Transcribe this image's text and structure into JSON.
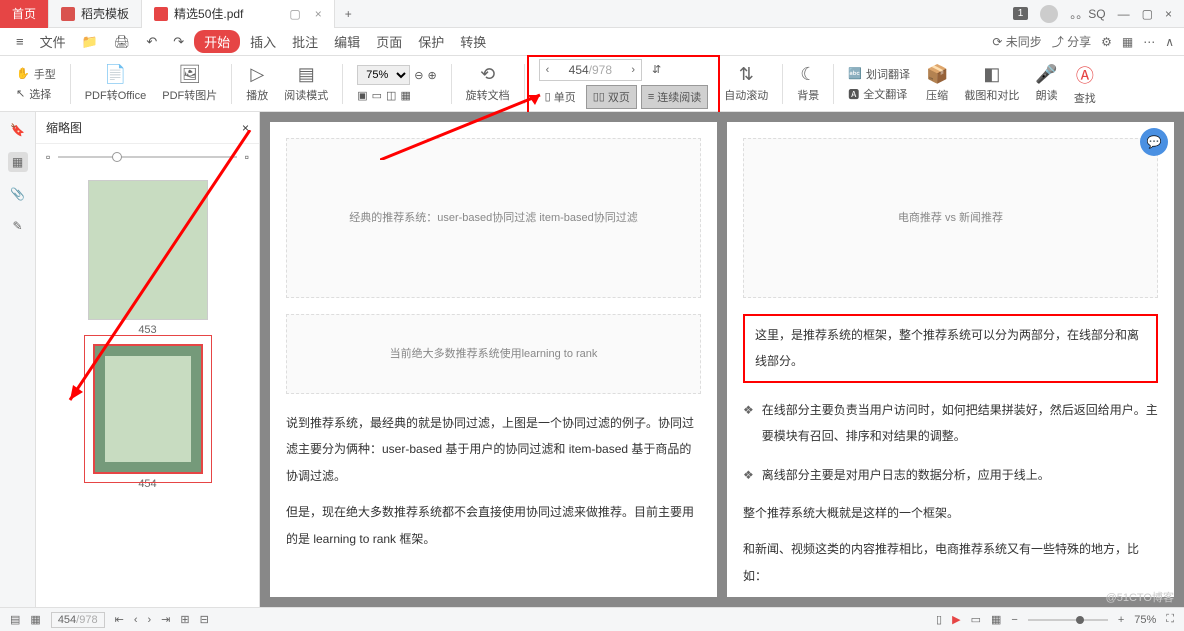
{
  "tabs": {
    "home": "首页",
    "template": "稻壳模板",
    "active": "精选50佳.pdf"
  },
  "window": {
    "badge": "1",
    "user": "。。SQ"
  },
  "menubar": {
    "file": "文件",
    "start": "开始",
    "items": [
      "插入",
      "批注",
      "编辑",
      "页面",
      "保护",
      "转换"
    ],
    "sync": "未同步",
    "share": "分享"
  },
  "toolbar": {
    "hand": "手型",
    "select": "选择",
    "pdf2office": "PDF转Office",
    "pdf2img": "PDF转图片",
    "play": "播放",
    "readmode": "阅读模式",
    "zoom": "75%",
    "rotate": "旋转文档",
    "page_current": "454",
    "page_total": "/978",
    "single": "单页",
    "double": "双页",
    "continuous": "连续阅读",
    "autoscroll": "自动滚动",
    "bg": "背景",
    "dict": "划词翻译",
    "fulltrans": "全文翻译",
    "compress": "压缩",
    "compare": "截图和对比",
    "read": "朗读",
    "find": "查找"
  },
  "thumb": {
    "title": "缩略图",
    "p1": "453",
    "p2": "454"
  },
  "doc": {
    "left": {
      "illus_caption1": "经典的推荐系统：user-based协同过滤 item-based协同过滤",
      "illus_caption2": "当前绝大多数推荐系统使用learning to rank",
      "p1": "说到推荐系统，最经典的就是协同过滤，上图是一个协同过滤的例子。协同过滤主要分为俩种：user-based 基于用户的协同过滤和 item-based 基于商品的协调过滤。",
      "p2": "但是，现在绝大多数推荐系统都不会直接使用协同过滤来做推荐。目前主要用的是 learning to rank 框架。"
    },
    "right": {
      "illus_caption": "电商推荐 vs 新闻推荐",
      "hl": "这里，是推荐系统的框架，整个推荐系统可以分为两部分，在线部分和离线部分。",
      "b1": "在线部分主要负责当用户访问时，如何把结果拼装好，然后返回给用户。主要模块有召回、排序和对结果的调整。",
      "b2": "离线部分主要是对用户日志的数据分析，应用于线上。",
      "p3": "整个推荐系统大概就是这样的一个框架。",
      "p4": "和新闻、视频这类的内容推荐相比，电商推荐系统又有一些特殊的地方，比如："
    }
  },
  "status": {
    "page_current": "454",
    "page_total": "/978",
    "zoom": "75%"
  },
  "watermark": "@51CTO博客"
}
